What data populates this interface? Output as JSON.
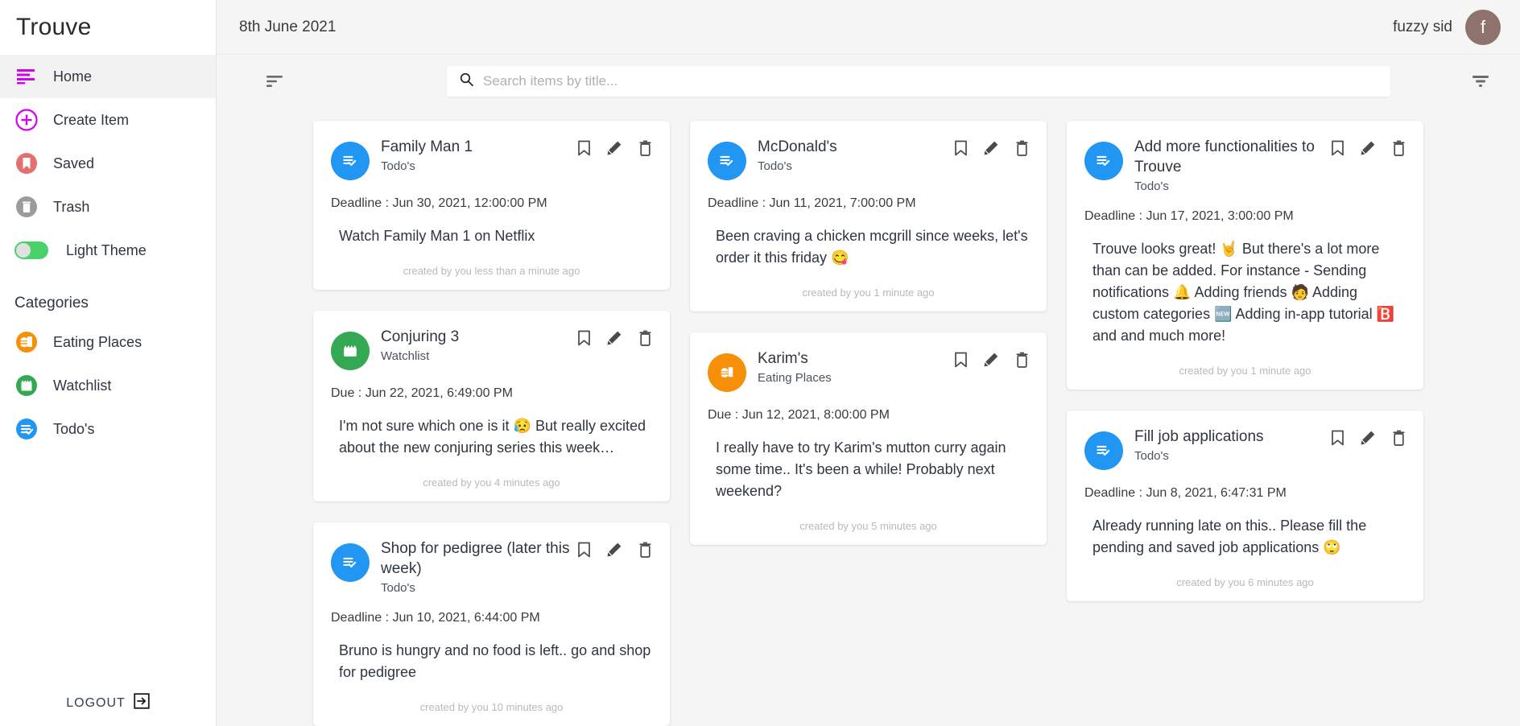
{
  "app": {
    "brand": "Trouve"
  },
  "sidebar": {
    "nav": [
      {
        "label": "Home",
        "icon": "menu-lines-icon",
        "active": true
      },
      {
        "label": "Create Item",
        "icon": "plus-circle-icon",
        "active": false
      },
      {
        "label": "Saved",
        "icon": "bookmark-circle-icon",
        "active": false
      },
      {
        "label": "Trash",
        "icon": "trash-circle-icon",
        "active": false
      }
    ],
    "theme_toggle": {
      "label": "Light Theme",
      "state": "on",
      "color": "#4ad26a"
    },
    "categories_title": "Categories",
    "categories": [
      {
        "label": "Eating Places",
        "icon": "burger-drink-icon",
        "color": "#f79009"
      },
      {
        "label": "Watchlist",
        "icon": "clapperboard-icon",
        "color": "#34a853"
      },
      {
        "label": "Todo's",
        "icon": "checklist-icon",
        "color": "#2196f3"
      }
    ],
    "logout": {
      "label": "LOGOUT",
      "icon": "logout-arrow-icon"
    }
  },
  "topbar": {
    "date": "8th June 2021",
    "username": "fuzzy sid",
    "avatar_initial": "f",
    "avatar_color": "#8d736b"
  },
  "toolbar": {
    "sort_icon": "sort-icon",
    "filter_icon": "filter-icon",
    "search": {
      "placeholder": "Search items by title...",
      "value": "",
      "icon": "search-icon"
    }
  },
  "card_actions": {
    "bookmark": "bookmark-icon",
    "edit": "edit-pencil-icon",
    "delete": "trash-icon"
  },
  "columns": [
    {
      "cards": [
        {
          "title": "Family Man 1",
          "category": "Todo's",
          "badge": "checklist-icon",
          "badge_color": "#2196f3",
          "deadline": "Deadline : Jun 30, 2021, 12:00:00 PM",
          "description": "Watch Family Man 1 on Netflix",
          "footer": "created by you less than a minute ago"
        },
        {
          "title": "Conjuring 3",
          "category": "Watchlist",
          "badge": "clapperboard-icon",
          "badge_color": "#34a853",
          "deadline": "Due : Jun 22, 2021, 6:49:00 PM",
          "description": "I'm not sure which one is it 😥 But really excited about the new conjuring series this week…",
          "footer": "created by you 4 minutes ago"
        },
        {
          "title": "Shop for pedigree (later this week)",
          "category": "Todo's",
          "badge": "checklist-icon",
          "badge_color": "#2196f3",
          "deadline": "Deadline : Jun 10, 2021, 6:44:00 PM",
          "description": "Bruno is hungry and no food is left.. go and shop for pedigree",
          "footer": "created by you 10 minutes ago"
        }
      ]
    },
    {
      "cards": [
        {
          "title": "McDonald's",
          "category": "Todo's",
          "badge": "checklist-icon",
          "badge_color": "#2196f3",
          "deadline": "Deadline : Jun 11, 2021, 7:00:00 PM",
          "description": "Been craving a chicken mcgrill since weeks, let's order it this friday 😋",
          "footer": "created by you 1 minute ago"
        },
        {
          "title": "Karim's",
          "category": "Eating Places",
          "badge": "burger-drink-icon",
          "badge_color": "#f79009",
          "deadline": "Due : Jun 12, 2021, 8:00:00 PM",
          "description": "I really have to try Karim's mutton curry again some time.. It's been a while! Probably next weekend?",
          "footer": "created by you 5 minutes ago"
        }
      ]
    },
    {
      "cards": [
        {
          "title": "Add more functionalities to Trouve",
          "category": "Todo's",
          "badge": "checklist-icon",
          "badge_color": "#2196f3",
          "deadline": "Deadline : Jun 17, 2021, 3:00:00 PM",
          "description": "Trouve looks great! 🤘 But there's a lot more than can be added. For instance - Sending notifications 🔔 Adding friends 🧑 Adding custom categories 🆕 Adding in-app tutorial 🅱️ and and much more!",
          "footer": "created by you 1 minute ago"
        },
        {
          "title": "Fill job applications",
          "category": "Todo's",
          "badge": "checklist-icon",
          "badge_color": "#2196f3",
          "deadline": "Deadline : Jun 8, 2021, 6:47:31 PM",
          "description": "Already running late on this.. Please fill the pending and saved job applications 🙄",
          "footer": "created by you 6 minutes ago"
        }
      ]
    }
  ]
}
